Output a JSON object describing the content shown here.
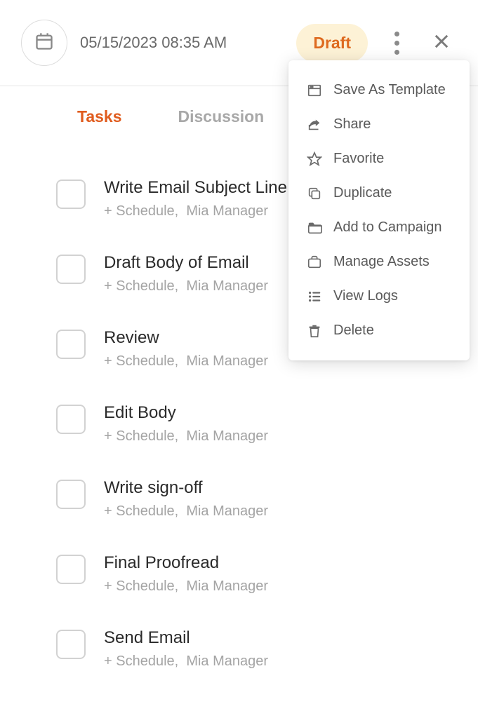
{
  "header": {
    "datetime": "05/15/2023 08:35 AM",
    "status": "Draft"
  },
  "tabs": [
    {
      "label": "Tasks",
      "active": true
    },
    {
      "label": "Discussion",
      "active": false
    }
  ],
  "tasks": [
    {
      "title": "Write Email Subject Line",
      "schedule": "+ Schedule,",
      "assignee": "Mia Manager"
    },
    {
      "title": "Draft Body of Email",
      "schedule": "+ Schedule,",
      "assignee": "Mia Manager"
    },
    {
      "title": "Review",
      "schedule": "+ Schedule,",
      "assignee": "Mia Manager"
    },
    {
      "title": "Edit Body",
      "schedule": "+ Schedule,",
      "assignee": "Mia Manager"
    },
    {
      "title": "Write sign-off",
      "schedule": "+ Schedule,",
      "assignee": "Mia Manager"
    },
    {
      "title": "Final Proofread",
      "schedule": "+ Schedule,",
      "assignee": "Mia Manager"
    },
    {
      "title": "Send Email",
      "schedule": "+ Schedule,",
      "assignee": "Mia Manager"
    }
  ],
  "menu": [
    {
      "label": "Save As Template",
      "icon": "template-icon"
    },
    {
      "label": "Share",
      "icon": "share-icon"
    },
    {
      "label": "Favorite",
      "icon": "star-icon"
    },
    {
      "label": "Duplicate",
      "icon": "copy-icon"
    },
    {
      "label": "Add to Campaign",
      "icon": "folder-icon"
    },
    {
      "label": "Manage Assets",
      "icon": "briefcase-icon"
    },
    {
      "label": "View Logs",
      "icon": "list-icon"
    },
    {
      "label": "Delete",
      "icon": "trash-icon"
    }
  ]
}
